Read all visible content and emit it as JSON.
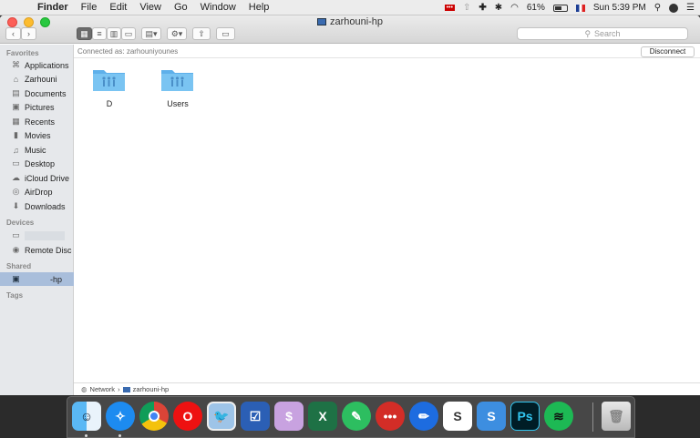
{
  "menubar": {
    "app": "Finder",
    "items": [
      "File",
      "Edit",
      "View",
      "Go",
      "Window",
      "Help"
    ],
    "battery": "61%",
    "clock": "Sun 5:39 PM"
  },
  "window": {
    "title": "zarhouni-hp"
  },
  "toolbar": {
    "search_placeholder": "Search"
  },
  "sidebar": {
    "favorites_header": "Favorites",
    "favorites": [
      {
        "label": "Applications",
        "icon": "applications-icon"
      },
      {
        "label": "Zarhouni",
        "icon": "home-icon"
      },
      {
        "label": "Documents",
        "icon": "documents-icon"
      },
      {
        "label": "Pictures",
        "icon": "pictures-icon"
      },
      {
        "label": "Recents",
        "icon": "recents-icon"
      },
      {
        "label": "Movies",
        "icon": "movies-icon"
      },
      {
        "label": "Music",
        "icon": "music-icon"
      },
      {
        "label": "Desktop",
        "icon": "desktop-icon"
      },
      {
        "label": "iCloud Drive",
        "icon": "cloud-icon"
      },
      {
        "label": "AirDrop",
        "icon": "airdrop-icon"
      },
      {
        "label": "Downloads",
        "icon": "downloads-icon"
      }
    ],
    "devices_header": "Devices",
    "devices": [
      {
        "label": "",
        "icon": "laptop-icon"
      },
      {
        "label": "Remote Disc",
        "icon": "disc-icon"
      }
    ],
    "shared_header": "Shared",
    "shared": [
      {
        "label": "-hp",
        "icon": "computer-icon"
      }
    ],
    "tags_header": "Tags"
  },
  "content": {
    "connected_as": "Connected as: zarhouniyounes",
    "disconnect_label": "Disconnect",
    "folders": [
      "D",
      "Users"
    ]
  },
  "pathbar": {
    "items": [
      "Network",
      "zarhouni-hp"
    ]
  },
  "dock": {
    "apps": [
      "Finder",
      "Safari",
      "Chrome",
      "Opera",
      "Preview",
      "Tasks",
      "Coins",
      "Excel",
      "Evernote",
      "LastPass",
      "Pencil",
      "Slack",
      "Snagit",
      "Photoshop",
      "Spotify",
      "Trash"
    ]
  },
  "colors": {
    "folder_blue": "#6cbcf0",
    "selection": "#a9bedb",
    "red_close": "#fc5f57"
  }
}
